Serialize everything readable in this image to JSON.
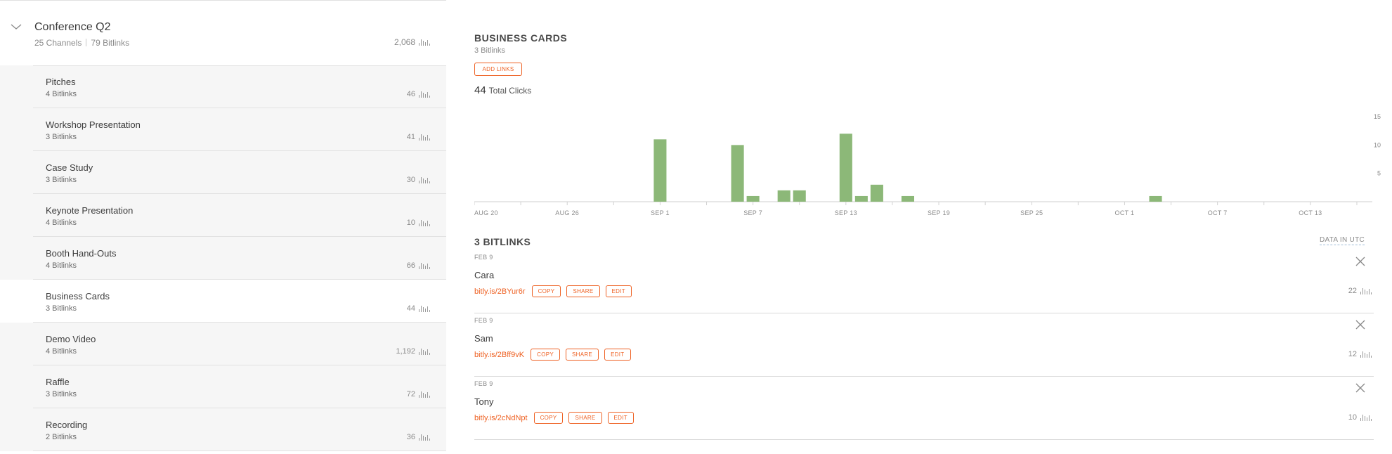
{
  "campaign": {
    "title": "Conference Q2",
    "channels_count": "25 Channels",
    "bitlinks_count": "79 Bitlinks",
    "clicks": "2,068"
  },
  "channels": [
    {
      "name": "Pitches",
      "bitlinks": "4 Bitlinks",
      "clicks": "46",
      "active": false
    },
    {
      "name": "Workshop Presentation",
      "bitlinks": "3 Bitlinks",
      "clicks": "41",
      "active": false
    },
    {
      "name": "Case Study",
      "bitlinks": "3 Bitlinks",
      "clicks": "30",
      "active": false
    },
    {
      "name": "Keynote Presentation",
      "bitlinks": "4 Bitlinks",
      "clicks": "10",
      "active": false
    },
    {
      "name": "Booth Hand-Outs",
      "bitlinks": "4 Bitlinks",
      "clicks": "66",
      "active": false
    },
    {
      "name": "Business Cards",
      "bitlinks": "3 Bitlinks",
      "clicks": "44",
      "active": true
    },
    {
      "name": "Demo Video",
      "bitlinks": "4 Bitlinks",
      "clicks": "1,192",
      "active": false
    },
    {
      "name": "Raffle",
      "bitlinks": "3 Bitlinks",
      "clicks": "72",
      "active": false
    },
    {
      "name": "Recording",
      "bitlinks": "2 Bitlinks",
      "clicks": "36",
      "active": false
    }
  ],
  "detail": {
    "title": "BUSINESS CARDS",
    "subtitle": "3 Bitlinks",
    "add_links_label": "ADD LINKS",
    "total_clicks_value": "44",
    "total_clicks_label": "Total Clicks",
    "list_header": "3 BITLINKS",
    "data_in_utc": "DATA IN UTC"
  },
  "chart_data": {
    "type": "bar",
    "title": "",
    "xlabel": "",
    "ylabel": "",
    "x_ticks": [
      "AUG 20",
      "AUG 26",
      "SEP 1",
      "SEP 7",
      "SEP 13",
      "SEP 19",
      "SEP 25",
      "OCT 1",
      "OCT 7",
      "OCT 13"
    ],
    "y_ticks": [
      5,
      10,
      15
    ],
    "ylim": [
      0,
      16
    ],
    "x_start": "Aug 20",
    "x_end": "Oct 17",
    "series": [
      {
        "color": "#8cb878",
        "points": [
          {
            "x": "Sep 1",
            "y": 11
          },
          {
            "x": "Sep 6",
            "y": 10
          },
          {
            "x": "Sep 7",
            "y": 1
          },
          {
            "x": "Sep 9",
            "y": 2
          },
          {
            "x": "Sep 10",
            "y": 2
          },
          {
            "x": "Sep 13",
            "y": 12
          },
          {
            "x": "Sep 14",
            "y": 1
          },
          {
            "x": "Sep 15",
            "y": 3
          },
          {
            "x": "Sep 17",
            "y": 1
          },
          {
            "x": "Oct 3",
            "y": 1
          }
        ]
      }
    ]
  },
  "links": [
    {
      "date": "FEB 9",
      "title": "Cara",
      "short": "bitly.is/2BYur6r",
      "copy": "COPY",
      "share": "SHARE",
      "edit": "EDIT",
      "clicks": "22"
    },
    {
      "date": "FEB 9",
      "title": "Sam",
      "short": "bitly.is/2Bff9vK",
      "copy": "COPY",
      "share": "SHARE",
      "edit": "EDIT",
      "clicks": "12"
    },
    {
      "date": "FEB 9",
      "title": "Tony",
      "short": "bitly.is/2cNdNpt",
      "copy": "COPY",
      "share": "SHARE",
      "edit": "EDIT",
      "clicks": "10"
    }
  ],
  "colors": {
    "accent": "#ee6123",
    "bar": "#8cb878",
    "active_row": "#ffffff",
    "inactive_row": "#f6f6f6"
  },
  "icons": {
    "collapse": "chevron-down-icon",
    "clicks": "bar-chart-icon",
    "delete": "close-icon"
  }
}
